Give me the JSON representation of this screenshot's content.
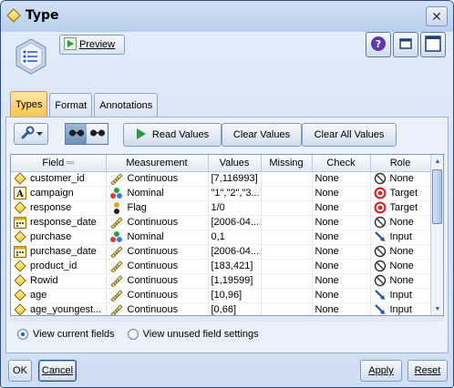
{
  "window": {
    "title": "Type",
    "app_icon": "diamond-icon",
    "close_label": "✕"
  },
  "header": {
    "preview_label": "Preview",
    "icons": [
      "help-icon",
      "minimize-icon",
      "maximize-icon"
    ]
  },
  "tabs": [
    {
      "label": "Types",
      "active": true
    },
    {
      "label": "Format",
      "active": false
    },
    {
      "label": "Annotations",
      "active": false
    }
  ],
  "toolbar": {
    "read_values_label": "Read Values",
    "clear_values_label": "Clear Values",
    "clear_all_values_label": "Clear All Values"
  },
  "table": {
    "columns": [
      "Field",
      "Measurement",
      "Values",
      "Missing",
      "Check",
      "Role"
    ],
    "rows": [
      {
        "field": "customer_id",
        "field_icon": "diamond-icon",
        "measurement": "Continuous",
        "meas_icon": "ruler-icon",
        "values": "[7,116993]",
        "missing": "",
        "check": "None",
        "role": "None",
        "role_icon": "none-icon"
      },
      {
        "field": "campaign",
        "field_icon": "text-A-icon",
        "measurement": "Nominal",
        "meas_icon": "nominal-icon",
        "values": "\"1\",\"2\",\"3...",
        "missing": "",
        "check": "None",
        "role": "Target",
        "role_icon": "target-icon"
      },
      {
        "field": "response",
        "field_icon": "diamond-icon",
        "measurement": "Flag",
        "meas_icon": "flag-icon",
        "values": "1/0",
        "missing": "",
        "check": "None",
        "role": "Target",
        "role_icon": "target-icon"
      },
      {
        "field": "response_date",
        "field_icon": "date-icon",
        "measurement": "Continuous",
        "meas_icon": "ruler-icon",
        "values": "[2006-04...",
        "missing": "",
        "check": "None",
        "role": "None",
        "role_icon": "none-icon"
      },
      {
        "field": "purchase",
        "field_icon": "diamond-icon",
        "measurement": "Nominal",
        "meas_icon": "nominal-icon",
        "values": "0,1",
        "missing": "",
        "check": "None",
        "role": "Input",
        "role_icon": "input-arrow-icon"
      },
      {
        "field": "purchase_date",
        "field_icon": "date-icon",
        "measurement": "Continuous",
        "meas_icon": "ruler-icon",
        "values": "[2006-04...",
        "missing": "",
        "check": "None",
        "role": "None",
        "role_icon": "none-icon"
      },
      {
        "field": "product_id",
        "field_icon": "diamond-icon",
        "measurement": "Continuous",
        "meas_icon": "ruler-icon",
        "values": "[183,421]",
        "missing": "",
        "check": "None",
        "role": "None",
        "role_icon": "none-icon"
      },
      {
        "field": "Rowid",
        "field_icon": "diamond-icon",
        "measurement": "Continuous",
        "meas_icon": "ruler-icon",
        "values": "[1,19599]",
        "missing": "",
        "check": "None",
        "role": "None",
        "role_icon": "none-icon"
      },
      {
        "field": "age",
        "field_icon": "diamond-icon",
        "measurement": "Continuous",
        "meas_icon": "ruler-icon",
        "values": "[10,96]",
        "missing": "",
        "check": "None",
        "role": "Input",
        "role_icon": "input-arrow-icon"
      },
      {
        "field": "age_youngest...",
        "field_icon": "diamond-icon",
        "measurement": "Continuous",
        "meas_icon": "ruler-icon",
        "values": "[0,66]",
        "missing": "",
        "check": "None",
        "role": "Input",
        "role_icon": "input-arrow-icon"
      }
    ]
  },
  "options": {
    "view_current_label": "View current fields",
    "view_unused_label": "View unused field settings",
    "selected": "view_current"
  },
  "footer": {
    "ok_label": "OK",
    "cancel_label": "Cancel",
    "apply_label": "Apply",
    "reset_label": "Reset"
  }
}
